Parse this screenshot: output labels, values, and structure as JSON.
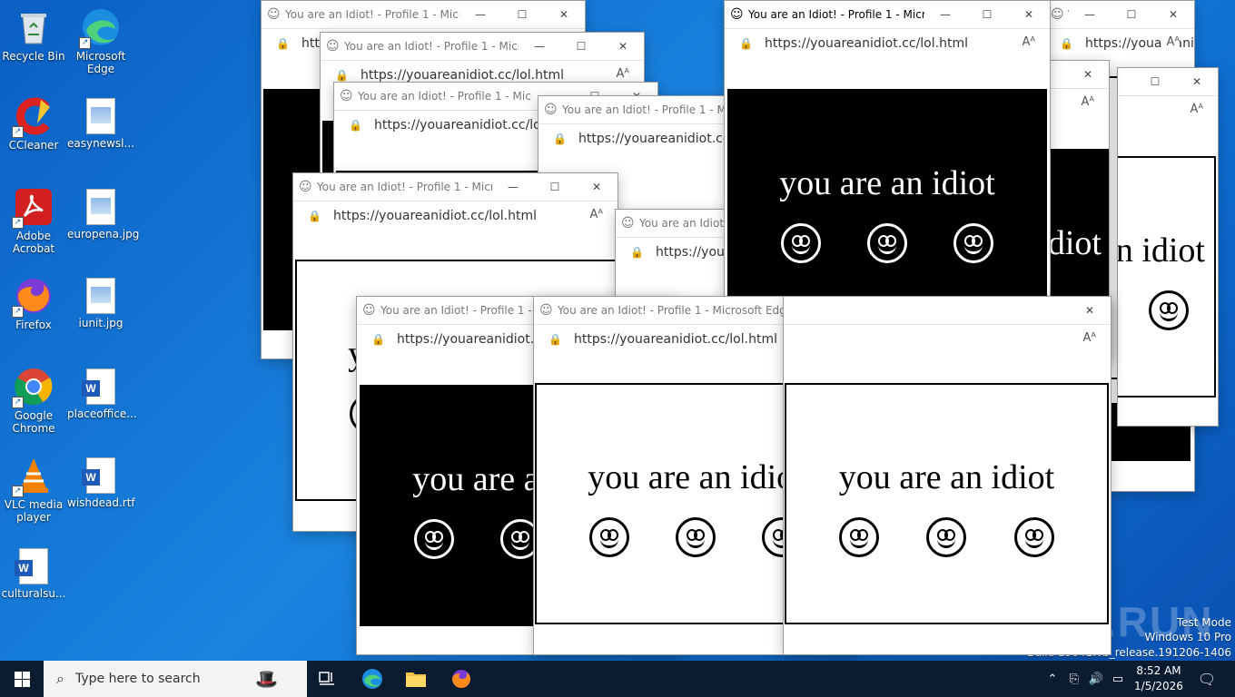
{
  "desktop": {
    "icons": [
      {
        "label": "Recycle Bin",
        "icon": "recycle-bin-icon"
      },
      {
        "label": "Microsoft Edge",
        "icon": "edge-icon"
      },
      {
        "label": "CCleaner",
        "icon": "ccleaner-icon"
      },
      {
        "label": "easynewsl...",
        "icon": "image-file-icon"
      },
      {
        "label": "Adobe Acrobat",
        "icon": "acrobat-icon"
      },
      {
        "label": "europena.jpg",
        "icon": "image-file-icon"
      },
      {
        "label": "Firefox",
        "icon": "firefox-icon"
      },
      {
        "label": "iunit.jpg",
        "icon": "image-file-icon"
      },
      {
        "label": "Google Chrome",
        "icon": "chrome-icon"
      },
      {
        "label": "placeoffice...",
        "icon": "word-doc-icon"
      },
      {
        "label": "VLC media player",
        "icon": "vlc-icon"
      },
      {
        "label": "wishdead.rtf",
        "icon": "word-doc-icon"
      },
      {
        "label": "culturalsu...",
        "icon": "word-doc-icon"
      }
    ]
  },
  "browser": {
    "title": "You are an Idiot! - Profile 1 - Microsoft Edge",
    "url": "https://youareanidiot.cc/lol.html",
    "message": "you are an idiot",
    "favicon": "smiley-icon",
    "read_aloud": "Ạͅ",
    "minimize": "—",
    "maximize": "☐",
    "close": "✕"
  },
  "taskbar": {
    "search_placeholder": "Type here to search",
    "time": "8:52 AM",
    "date": "1/5/2026",
    "pinned": [
      "task-view-icon",
      "edge-icon",
      "file-explorer-icon",
      "firefox-icon"
    ]
  },
  "watermark": {
    "line1": "Test Mode",
    "line2": "Windows 10 Pro",
    "line3": "Build 19041.vb_release.191206-1406",
    "brand": "ANY.RUN"
  },
  "colors": {
    "desktop": "#1a84df",
    "taskbar": "#0b1c31"
  }
}
